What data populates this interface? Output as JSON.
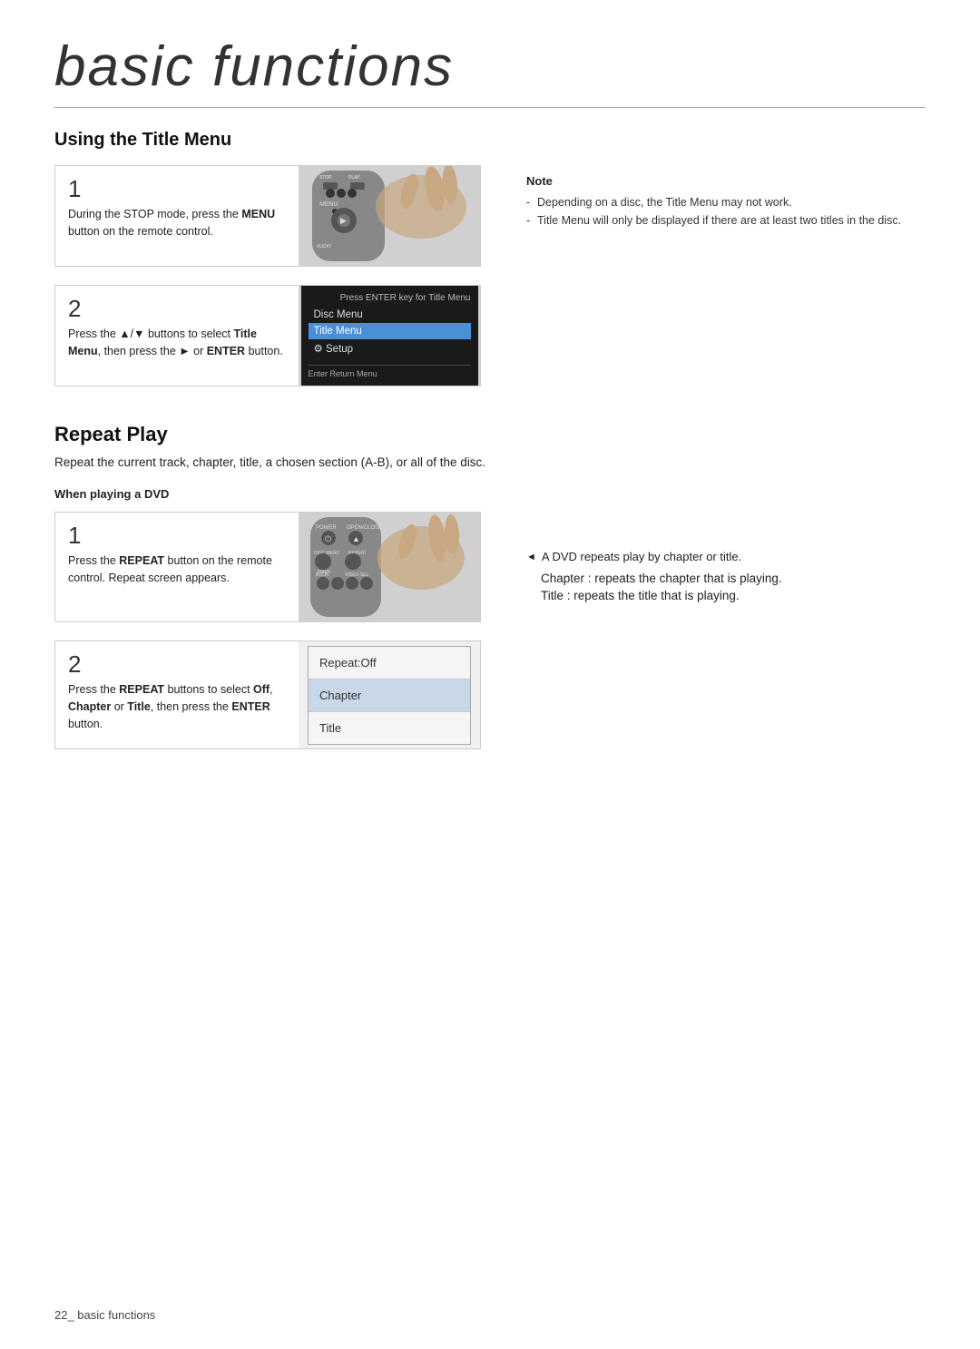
{
  "page": {
    "title": "basic functions",
    "footer": "22_ basic functions"
  },
  "title_menu_section": {
    "heading": "Using the Title Menu",
    "step1": {
      "number": "1",
      "text_parts": [
        {
          "text": "During the STOP mode, press the "
        },
        {
          "text": "MENU",
          "bold": true
        },
        {
          "text": " button on the remote control."
        }
      ]
    },
    "step2": {
      "number": "2",
      "text_parts": [
        {
          "text": "Press the ▲/▼ buttons to select "
        },
        {
          "text": "Title Menu",
          "bold": true
        },
        {
          "text": ", then press the ► or "
        },
        {
          "text": "ENTER",
          "bold": true
        },
        {
          "text": " button."
        }
      ]
    },
    "note": {
      "title": "Note",
      "items": [
        "Depending on a disc, the Title Menu may not work.",
        "Title Menu will only be displayed if there are at least two titles in the disc."
      ]
    },
    "screen": {
      "header": "Press ENTER key for Title Menu",
      "items": [
        {
          "label": "Disc Menu",
          "active": false
        },
        {
          "label": "Title Menu",
          "active": true
        },
        {
          "label": "Setup",
          "active": false
        }
      ],
      "footer": "Enter   Return   Menu"
    }
  },
  "repeat_play_section": {
    "heading": "Repeat Play",
    "description": "Repeat the current track, chapter, title, a chosen section (A-B), or all of the disc.",
    "dvd_label": "When playing a DVD",
    "step1": {
      "number": "1",
      "text_parts": [
        {
          "text": "Press the "
        },
        {
          "text": "REPEAT",
          "bold": true
        },
        {
          "text": " button on the remote control. Repeat screen appears."
        }
      ]
    },
    "step2": {
      "number": "2",
      "text_parts": [
        {
          "text": "Press the "
        },
        {
          "text": "REPEAT",
          "bold": true
        },
        {
          "text": " buttons to select "
        },
        {
          "text": "Off",
          "bold": true
        },
        {
          "text": ", "
        },
        {
          "text": "Chapter",
          "bold": true
        },
        {
          "text": " or "
        },
        {
          "text": "Title",
          "bold": true
        },
        {
          "text": ", then press the "
        },
        {
          "text": "ENTER",
          "bold": true
        },
        {
          "text": " button."
        }
      ]
    },
    "repeat_screen": {
      "items": [
        {
          "label": "Repeat:Off",
          "highlighted": false
        },
        {
          "label": "Chapter",
          "highlighted": true
        },
        {
          "label": "Title",
          "highlighted": false
        }
      ]
    },
    "note": {
      "bullet": "◄",
      "lines": [
        "A DVD repeats play by chapter or title.",
        "Chapter : repeats the chapter that is playing.",
        "Title : repeats the title that is playing."
      ]
    }
  }
}
